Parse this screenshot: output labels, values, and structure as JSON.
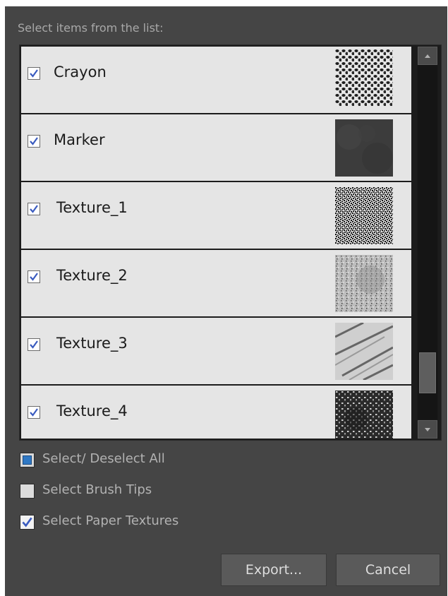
{
  "dialog": {
    "header": "Select items from the list:"
  },
  "items": [
    {
      "label": "Crayon",
      "checked": true,
      "texture": "crayon-texture"
    },
    {
      "label": "Marker",
      "checked": true,
      "texture": "marker-texture"
    },
    {
      "label": "Texture_1",
      "checked": true,
      "texture": "noise-texture"
    },
    {
      "label": "Texture_2",
      "checked": true,
      "texture": "grunge-texture"
    },
    {
      "label": "Texture_3",
      "checked": true,
      "texture": "streak-texture"
    },
    {
      "label": "Texture_4",
      "checked": true,
      "texture": "dark-grunge-texture"
    }
  ],
  "options": {
    "select_all": {
      "label": "Select/ Deselect All",
      "state": "partial"
    },
    "brush_tips": {
      "label": "Select Brush Tips",
      "state": "unchecked"
    },
    "paper_textures": {
      "label": "Select Paper Textures",
      "state": "checked"
    }
  },
  "buttons": {
    "export": "Export...",
    "cancel": "Cancel"
  },
  "colors": {
    "dialog_bg": "#454545",
    "item_bg": "#e5e5e5",
    "check_accent": "#3a5bbf"
  }
}
